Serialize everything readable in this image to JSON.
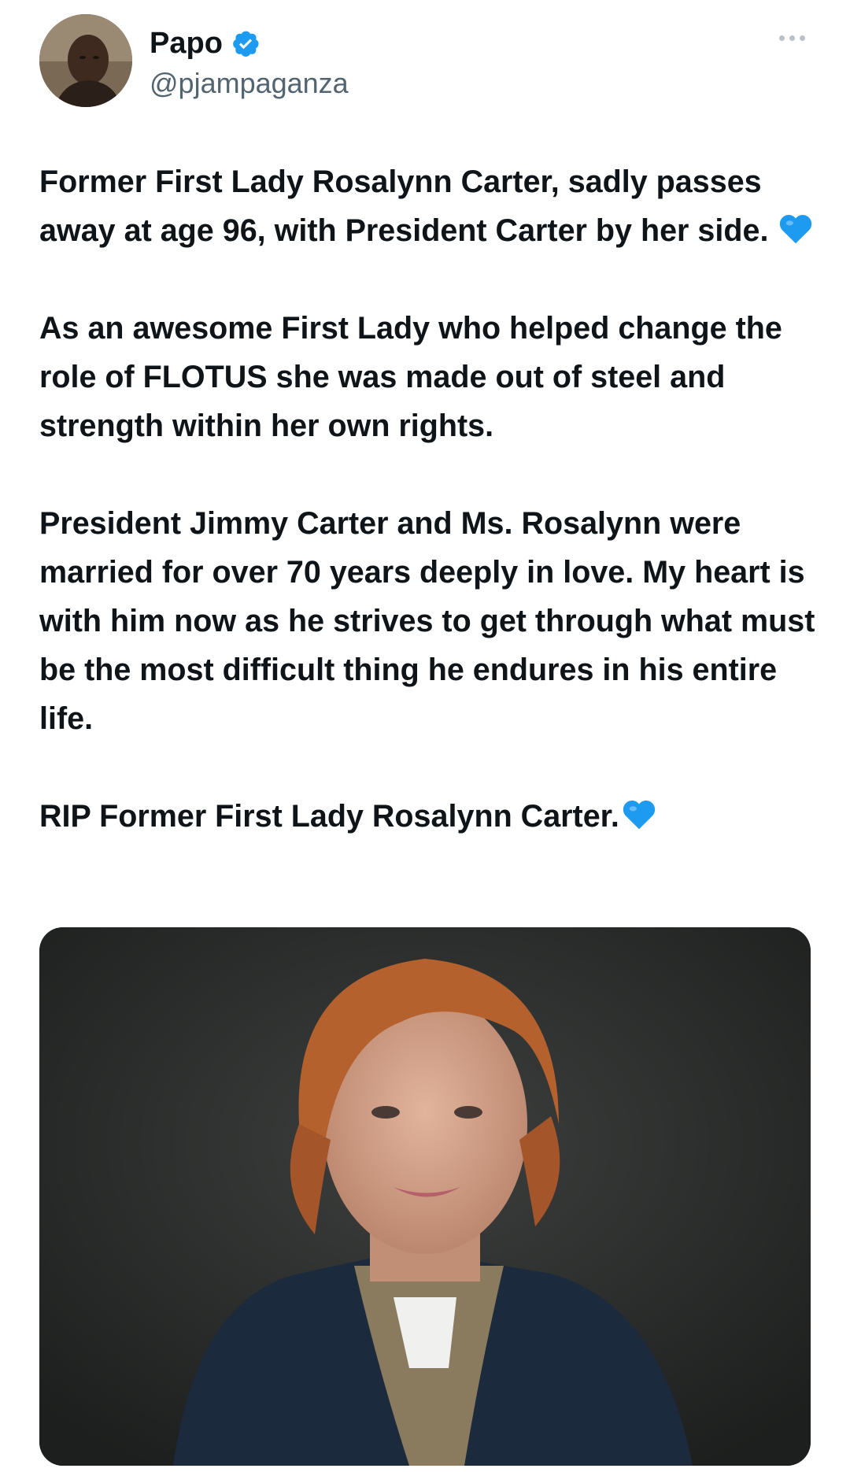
{
  "author": {
    "display_name": "Papo",
    "handle": "@pjampaganza",
    "verified": true,
    "verified_badge_color": "#1d9bf0",
    "avatar_icon": "avatar-photo"
  },
  "menu": {
    "more_icon": "more-horizontal-icon"
  },
  "tweet": {
    "paragraphs": [
      "Former First Lady Rosalynn Carter, sadly passes away at age 96, with President Carter by her side.",
      "As an awesome First Lady who helped change the role of FLOTUS she was made out of steel and strength within her own rights.",
      "President Jimmy Carter and Ms. Rosalynn were married for over 70 years deeply in love. My heart is with him now as he strives to get through what must be the most difficult thing he endures in his entire life.",
      "RIP Former First Lady Rosalynn Carter."
    ],
    "emoji": "blue-heart",
    "emoji_color": "#1d9bf0"
  },
  "media": {
    "type": "photo",
    "subject": "portrait-photo"
  }
}
